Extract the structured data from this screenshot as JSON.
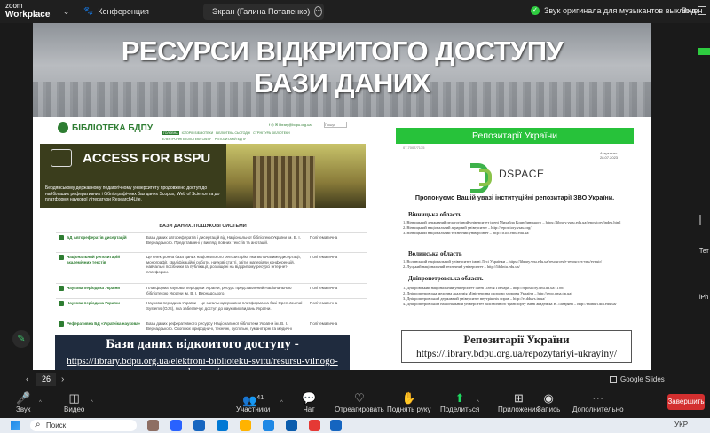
{
  "app": {
    "logo_line1": "zoom",
    "logo_line2": "Workplace",
    "conference_label": "Конференция",
    "share_label": "Экран (Галина Потапенко)",
    "original_sound": "Звук оригинала для музыкантов выключен",
    "view_label": "Вид"
  },
  "slide": {
    "banner_line1": "РЕСУРСИ ВІДКРИТОГО ДОСТУПУ",
    "banner_line2": "БАЗИ ДАНИХ",
    "library": {
      "logo": "БІБЛІОТЕКА БДПУ",
      "nav": [
        "ГОЛОВНА",
        "ІСТОРІЯ БІБЛІОТЕКИ",
        "БІБЛІОТЕКА СЬОГОДНІ",
        "СТРУКТУРА БІБЛІОТЕКИ"
      ],
      "nav2": [
        "ЕЛЕКТРОННІ БІБЛІОТЕКИ СВІТУ",
        "РЕПОЗИТАРІЙ БДПУ"
      ],
      "contact": "f ◎ ✉ library@bdpu.org.ua",
      "search_placeholder": "Пошук"
    },
    "access": {
      "title": "ACCESS FOR BSPU",
      "desc": "Бердянському державному педагогічному університету продовжено доступ до найбільших реферативних і бібліографічних баз даних Scopus, Web of Science та до платформи наукової літератури Research4Life."
    },
    "table_title": "БАЗИ ДАНИХ. ПОШУКОВІ СИСТЕМИ",
    "rows": [
      {
        "name": "БД Авторефератів дисертацій",
        "desc": "База даних авторефератів і дисертацій від Національної бібліотеки України ім. В. І. Вернадського. Представлені у вигляді повних текстів та анотацій.",
        "kind": "Політематична"
      },
      {
        "name": "Національний репозитарій академічних текстів",
        "desc": "Це електронна база даних національного репозитарію, яка включатиме дисертації, монографії, кваліфікаційні роботи, наукові статті, звіти, матеріали конференцій, навчальні посібники та публікації, розміщені на відкритому ресурсі Інтернет-платформи.",
        "kind": "Політематична"
      },
      {
        "name": "Наукова періодика України",
        "desc": "Платформа наукової періодики України, ресурс представлений Національною бібліотекою України ім. В. І. Вернадського.",
        "kind": "Політематична"
      },
      {
        "name": "Наукова періодика України",
        "desc": "Наукова періодика України – це загальнодержавна платформа на базі Open Journal Systems (OJS), яка забезпечує доступ до наукових видань України.",
        "kind": "Політематична"
      },
      {
        "name": "Реферативна БД «Україніка наукова»",
        "desc": "База даних реферативного ресурсу Національної бібліотеки України ім. В. І. Вернадського. Охоплює природничі, технічні, суспільні, гуманітарні та медичні",
        "kind": "Політематична"
      }
    ],
    "bottom_title": "Бази даних відкоитого доступу -",
    "bottom_url": "https://library.bdpu.org.ua/elektroni-biblioteku-svitu/resursu-vilnogo-dostupu/",
    "repo_header": "Репозитарії України",
    "repo_small": "07.7007/7135",
    "repo_date": "Актуально 28.07.2023",
    "dspace_word": "DSPACE",
    "propose": "Пропонуємо Вашій увазі інституційні репозитарії  ЗВО України.",
    "regions": [
      {
        "title": "Вінницька область",
        "items": [
          "1. Вінницький державний педагогічний університет імені Михайла Коцюбинського – https://library.vspu.edu.ua/repository/index.html",
          "2. Вінницький національний аграрний університет – http://repository.vsau.org/",
          "3. Вінницький національний технічний університет – http://ir.lib.vntu.edu.ua/"
        ]
      },
      {
        "title": "Волинська область",
        "items": [
          "1. Волинський національний університет імені Лесі Українки – https://library.vnu.edu.ua/resources/e-resources-vnu/evnuir/",
          "2. Луцький національний технічний університет – http://lib.lntu.edu.ua/"
        ]
      },
      {
        "title": "Дніпропетровська область",
        "items": [
          "1. Дніпровський національний університет імені Олеся Гончара – http://repository.dnu.dp.ua:1100/",
          "2. Дніпропетровська медична академія Міністерства охорони здоров'я України – http://repo.dma.dp.ua/",
          "3. Дніпропетровський державний університет внутрішніх справ – http://er.dduvs.in.ua/",
          "4. Дніпропетровський національний університет залізничного транспорту імені академіка В. Лазаряна – http://eadnurt.diit.edu.ua/"
        ]
      }
    ],
    "repo_box_title": "Репозитарії України",
    "repo_box_url": "https://library.bdpu.org.ua/repozytariyi-ukrayiny/"
  },
  "controls": {
    "page": "26",
    "google_slides": "Google Slides"
  },
  "sidebar": {
    "labels": [
      "Тет",
      "іPh"
    ]
  },
  "toolbar": {
    "audio": "Звук",
    "video": "Видео",
    "participants": "Участники",
    "participants_count": "41",
    "chat": "Чат",
    "react": "Отреагировать",
    "raise": "Поднять руку",
    "share": "Поделиться",
    "apps": "Приложения",
    "record": "Запись",
    "more": "Дополнительно",
    "finish": "Завершить"
  },
  "taskbar": {
    "search": "Поиск",
    "lang": "УКР"
  },
  "colors": {
    "green": "#27c23a",
    "navy": "#1f2b3e",
    "zoom_bg": "#1a1a1a"
  }
}
